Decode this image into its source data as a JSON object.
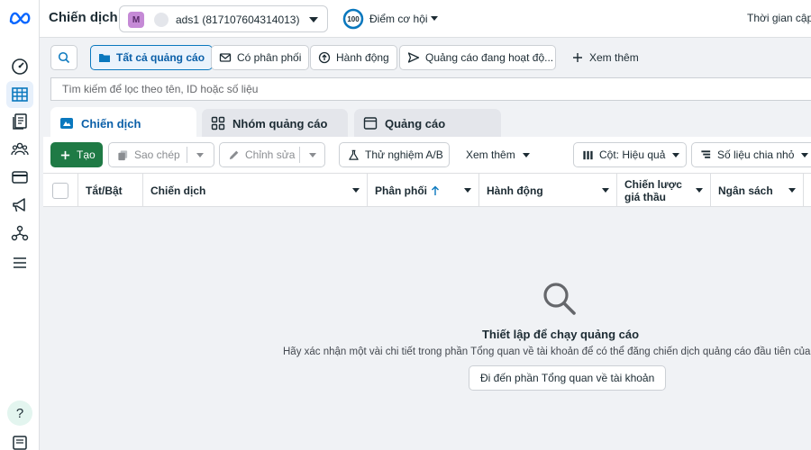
{
  "topbar": {
    "title": "Chiến dịch",
    "account": {
      "avatar_letter": "M",
      "name": "ads1 (817107604314013)"
    },
    "score": {
      "value": "100",
      "label": "Điểm cơ hội"
    },
    "time_label": "Thời gian cập nhật"
  },
  "filters": {
    "all_ads": "Tất cả quảng cáo",
    "delivering": "Có phân phối",
    "actions": "Hành động",
    "active_ads": "Quảng cáo đang hoạt độ...",
    "more": "Xem thêm"
  },
  "search": {
    "placeholder": "Tìm kiếm để lọc theo tên, ID hoặc số liệu"
  },
  "tabs": [
    {
      "label": "Chiến dịch"
    },
    {
      "label": "Nhóm quảng cáo"
    },
    {
      "label": "Quảng cáo"
    }
  ],
  "actions": {
    "create": "Tạo",
    "duplicate": "Sao chép",
    "edit": "Chỉnh sửa",
    "ab_test": "Thử nghiệm A/B",
    "more": "Xem thêm",
    "columns": "Cột: Hiệu quả",
    "breakdown": "Số liệu chia nhỏ"
  },
  "table": {
    "columns": [
      "Tắt/Bật",
      "Chiến dịch",
      "Phân phối",
      "Hành động",
      "Chiến lược giá thầu",
      "Ngân sách"
    ]
  },
  "empty_state": {
    "title": "Thiết lập để chạy quảng cáo",
    "description": "Hãy xác nhận một vài chi tiết trong phần Tổng quan về tài khoản để có thể đăng chiến dịch quảng cáo đầu tiên của bạn.",
    "button": "Đi đến phần Tổng quan về tài khoản"
  },
  "colors": {
    "primary": "#0a78be",
    "create_green": "#1f7a45",
    "bg": "#f0f2f5"
  }
}
